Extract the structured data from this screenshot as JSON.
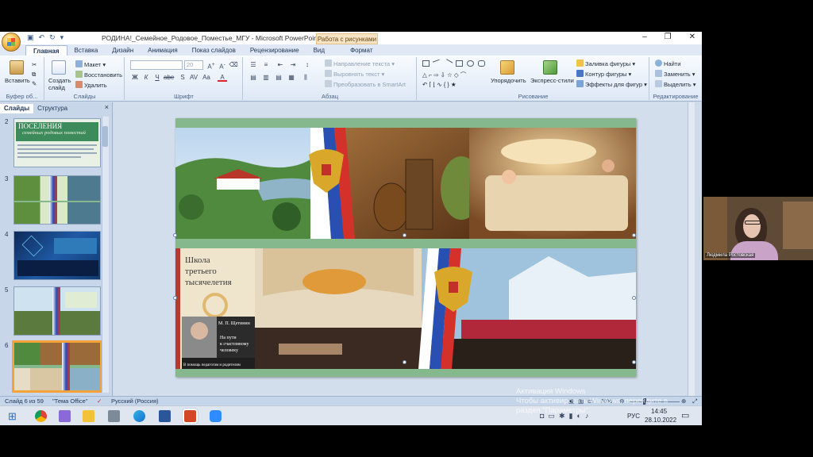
{
  "window": {
    "title": "РОДИНА!_Семейное_Родовое_Поместье_МГУ - Microsoft PowerPoint",
    "context_tab_title": "Работа с рисунками",
    "controls": {
      "minimize": "–",
      "maximize": "❐",
      "close": "✕"
    }
  },
  "tabs": [
    "Главная",
    "Вставка",
    "Дизайн",
    "Анимация",
    "Показ слайдов",
    "Рецензирование",
    "Вид",
    "Формат"
  ],
  "active_tab": "Главная",
  "ribbon": {
    "clipboard": {
      "label": "Буфер об...",
      "paste": "Вставить"
    },
    "slides": {
      "label": "Слайды",
      "new_slide": "Создать слайд",
      "layout": "Макет",
      "reset": "Восстановить",
      "delete": "Удалить"
    },
    "font": {
      "label": "Шрифт",
      "size": "20"
    },
    "paragraph": {
      "label": "Абзац",
      "text_direction": "Направление текста",
      "align_text": "Выровнять текст",
      "smartart": "Преобразовать в SmartArt"
    },
    "drawing": {
      "label": "Рисование",
      "arrange": "Упорядочить",
      "quick_styles": "Экспресс-стили",
      "fill": "Заливка фигуры",
      "outline": "Контур фигуры",
      "effects": "Эффекты для фигур"
    },
    "editing": {
      "label": "Редактирование",
      "find": "Найти",
      "replace": "Заменить",
      "select": "Выделить"
    }
  },
  "pane": {
    "tab_slides": "Слайды",
    "tab_outline": "Структура",
    "close": "×",
    "thumbs": [
      {
        "num": "2",
        "title": "ПОСЕЛЕНИЯ",
        "subtitle": "семейных родовых поместий"
      },
      {
        "num": "3"
      },
      {
        "num": "4"
      },
      {
        "num": "5"
      },
      {
        "num": "6"
      }
    ]
  },
  "slide": {
    "book_title": "Школа третьего тысячелетия",
    "book_author": "М. П. Щетинин",
    "book_subtitle": "На пути к счастливому человеку",
    "book_footer": "В помощь педагогам и родителям"
  },
  "status": {
    "slide_pos": "Слайд 6 из 59",
    "theme": "\"Тема Office\"",
    "language": "Русский (Россия)",
    "zoom": "70%"
  },
  "watermark": {
    "line1": "Активация Windows",
    "line2": "Чтобы активировать Windows, перейдите в",
    "line3": "раздел \"Параметры\"."
  },
  "taskbar": {
    "time": "14:45",
    "date": "28.10.2022",
    "lang": "РУС"
  },
  "webcam": {
    "name": "Людмила Ростовская"
  }
}
